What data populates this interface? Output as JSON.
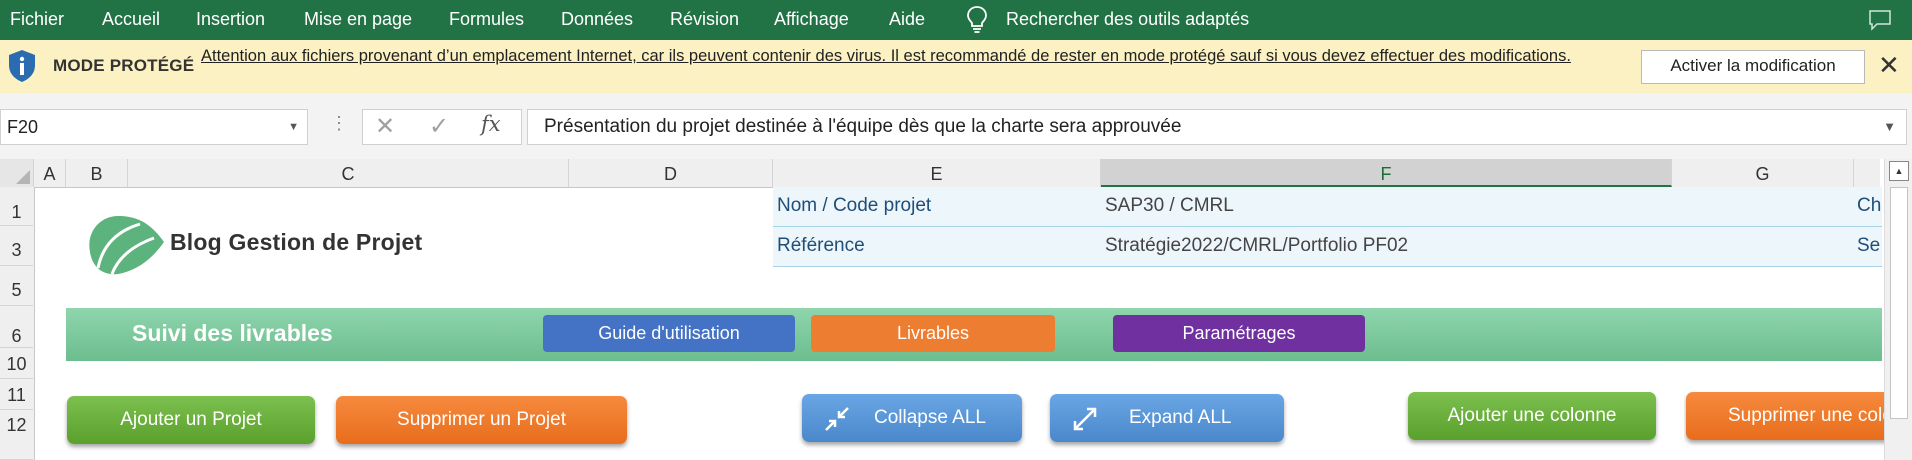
{
  "ribbon": {
    "menu": [
      "Fichier",
      "Accueil",
      "Insertion",
      "Mise en page",
      "Formules",
      "Données",
      "Révision",
      "Affichage",
      "Aide"
    ],
    "search_label": "Rechercher des outils adaptés",
    "search_icon": "lightbulb-icon",
    "comment_icon": "comment-icon",
    "bg_color": "#217346"
  },
  "protected": {
    "icon": "shield-info-icon",
    "title": "MODE PROTÉGÉ",
    "message": "Attention aux fichiers provenant d’un emplacement Internet, car ils peuvent contenir des virus. Il est recommandé de rester en mode protégé sauf si vous devez effectuer des modifications.",
    "enable_button": "Activer la modification",
    "close_icon": "close-icon",
    "bg_color": "#fcf1c2"
  },
  "formula_bar": {
    "name_box": "F20",
    "cancel_icon": "cancel-x-icon",
    "enter_icon": "checkmark-icon",
    "function_icon": "fx-icon",
    "fx_symbol": "fx",
    "content": "Présentation du projet destinée à l'équipe dès que la charte sera approuvée"
  },
  "grid": {
    "columns": [
      "A",
      "B",
      "C",
      "D",
      "E",
      "F",
      "G"
    ],
    "selected_column": "F",
    "rows": [
      "1",
      "3",
      "5",
      "6",
      "10",
      "11",
      "12"
    ]
  },
  "logo": {
    "text": "Blog Gestion de Projet",
    "icon": "leaf-logo-icon",
    "color": "#5db37e"
  },
  "project_info": [
    {
      "label": "Nom / Code projet",
      "value": "SAP30 / CMRL",
      "extra": "Ch"
    },
    {
      "label": "Référence",
      "value": "Stratégie2022/CMRL/Portfolio PF02",
      "extra": "Se"
    }
  ],
  "banner": {
    "title": "Suivi des livrables",
    "buttons": [
      {
        "label": "Guide d'utilisation",
        "color": "#4472c4"
      },
      {
        "label": "Livrables",
        "color": "#ed7d31"
      },
      {
        "label": "Paramétrages",
        "color": "#7030a0"
      }
    ]
  },
  "actions": {
    "add_project": "Ajouter un Projet",
    "delete_project": "Supprimer un Projet",
    "collapse_all": "Collapse ALL",
    "collapse_icon": "collapse-arrows-icon",
    "expand_all": "Expand ALL",
    "expand_icon": "expand-arrows-icon",
    "add_column": "Ajouter une colonne",
    "delete_column": "Supprimer une colonne"
  }
}
